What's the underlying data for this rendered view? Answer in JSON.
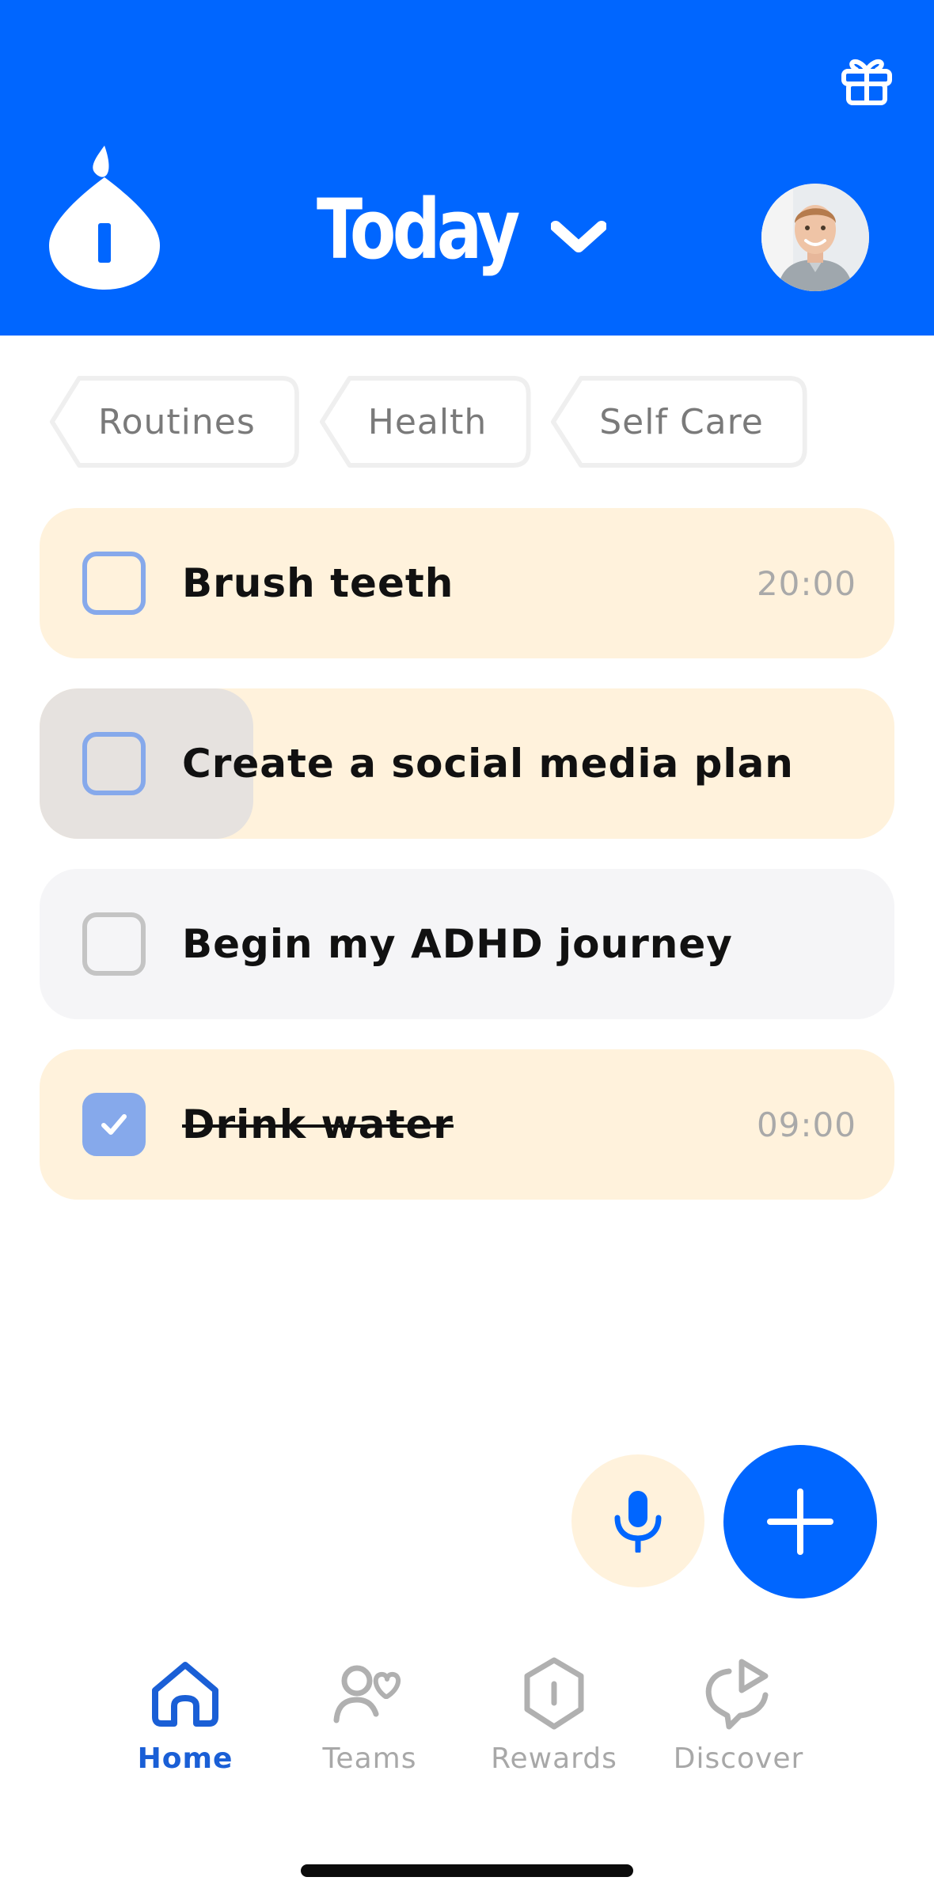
{
  "header": {
    "title": "Today",
    "gift_icon": "gift-icon",
    "logo_icon": "app-logo-drop",
    "chevron_icon": "chevron-down-icon",
    "background_color": "#0066ff"
  },
  "chips": [
    "Routines",
    "Health",
    "Self Care"
  ],
  "tasks": [
    {
      "label": "Brush teeth",
      "time": "20:00",
      "done": false,
      "bg": "cream"
    },
    {
      "label": "Create a social media plan",
      "time": "",
      "done": false,
      "bg": "cream"
    },
    {
      "label": "Begin my ADHD journey",
      "time": "",
      "done": false,
      "bg": "grey"
    },
    {
      "label": "Drink water",
      "time": "09:00",
      "done": true,
      "bg": "cream"
    }
  ],
  "actions": {
    "mic_icon": "microphone-icon",
    "add_icon": "plus-icon"
  },
  "nav": {
    "items": [
      {
        "label": "Home",
        "icon": "home-icon",
        "active": true
      },
      {
        "label": "Teams",
        "icon": "teams-icon",
        "active": false
      },
      {
        "label": "Rewards",
        "icon": "rewards-icon",
        "active": false
      },
      {
        "label": "Discover",
        "icon": "discover-icon",
        "active": false
      }
    ]
  },
  "colors": {
    "accent": "#0066ff",
    "cream": "#fff2dc",
    "checkbox": "#86a9eb"
  }
}
